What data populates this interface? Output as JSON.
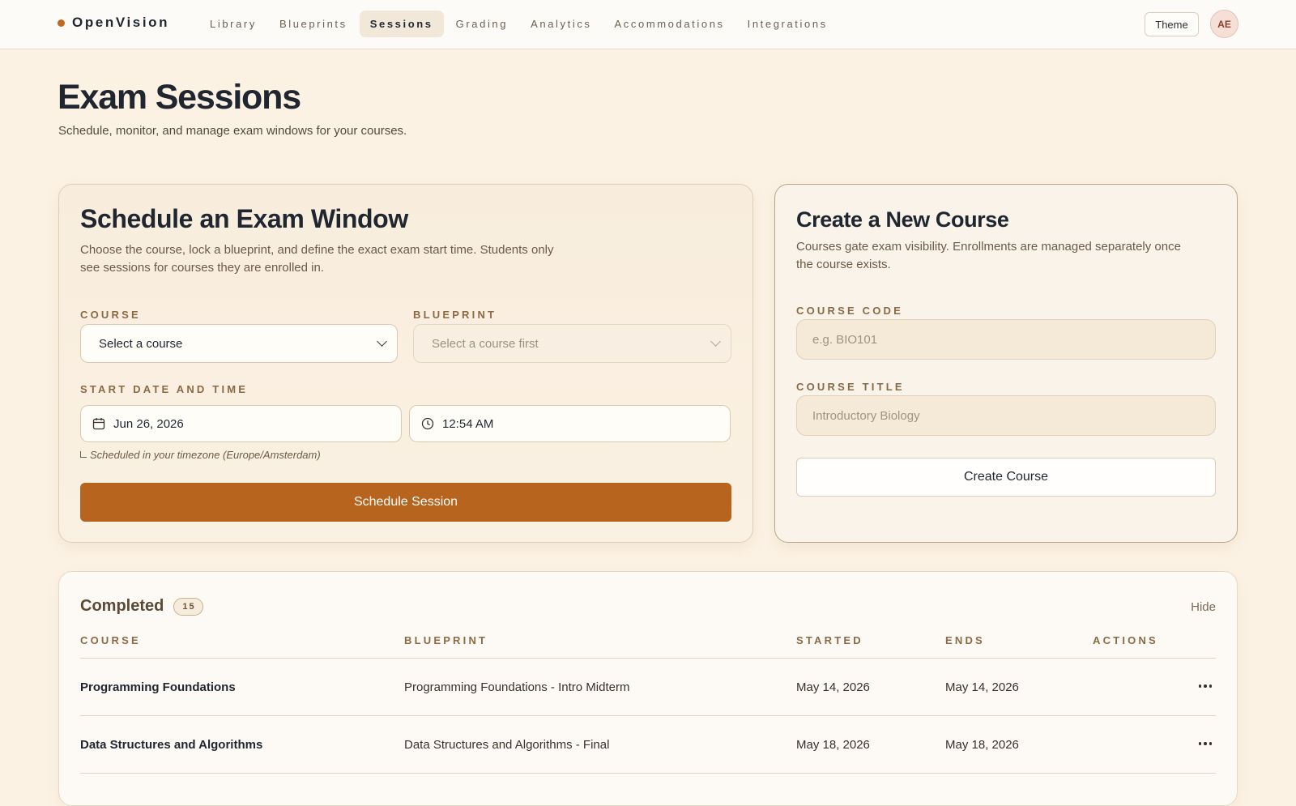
{
  "app": {
    "brand": "OpenVision",
    "nav": [
      "Library",
      "Blueprints",
      "Sessions",
      "Grading",
      "Analytics",
      "Accommodations",
      "Integrations"
    ],
    "active_nav": "Sessions",
    "theme_label": "Theme",
    "avatar_initials": "AE"
  },
  "header": {
    "title": "Exam Sessions",
    "subtitle": "Schedule, monitor, and manage exam windows for your courses."
  },
  "schedule": {
    "title": "Schedule an Exam Window",
    "description_line1": "Choose the course, lock a blueprint, and define the exact exam start time. Students only",
    "description_line2": "see sessions for courses they are enrolled in.",
    "course_label": "COURSE",
    "course_value": "Select a course",
    "blueprint_label": "BLUEPRINT",
    "blueprint_value": "Select a course first",
    "datetime_label": "START DATE AND TIME",
    "date_value": "Jun 26, 2026",
    "time_value": "12:54 AM",
    "timezone_note": "Scheduled in your timezone (Europe/Amsterdam)",
    "submit_label": "Schedule Session"
  },
  "new_course": {
    "title": "Create a New Course",
    "description_line1": "Courses gate exam visibility. Enrollments are managed separately once",
    "description_line2": "the course exists.",
    "code_label": "COURSE CODE",
    "code_placeholder": "e.g. BIO101",
    "title_label": "COURSE TITLE",
    "title_placeholder": "Introductory Biology",
    "submit_label": "Create Course"
  },
  "completed": {
    "heading": "Completed",
    "count": "15",
    "hide_label": "Hide",
    "columns": {
      "course": "COURSE",
      "blueprint": "BLUEPRINT",
      "started": "STARTED",
      "ends": "ENDS",
      "actions": "ACTIONS"
    },
    "rows": [
      {
        "course": "Programming Foundations",
        "blueprint": "Programming Foundations - Intro Midterm",
        "started": "May 14, 2026",
        "ends": "May 14, 2026"
      },
      {
        "course": "Data Structures and Algorithms",
        "blueprint": "Data Structures and Algorithms - Final",
        "started": "May 18, 2026",
        "ends": "May 18, 2026"
      }
    ]
  },
  "colors": {
    "accent": "#b7651e",
    "background": "#fcf2e4",
    "label": "#8a6a43"
  }
}
